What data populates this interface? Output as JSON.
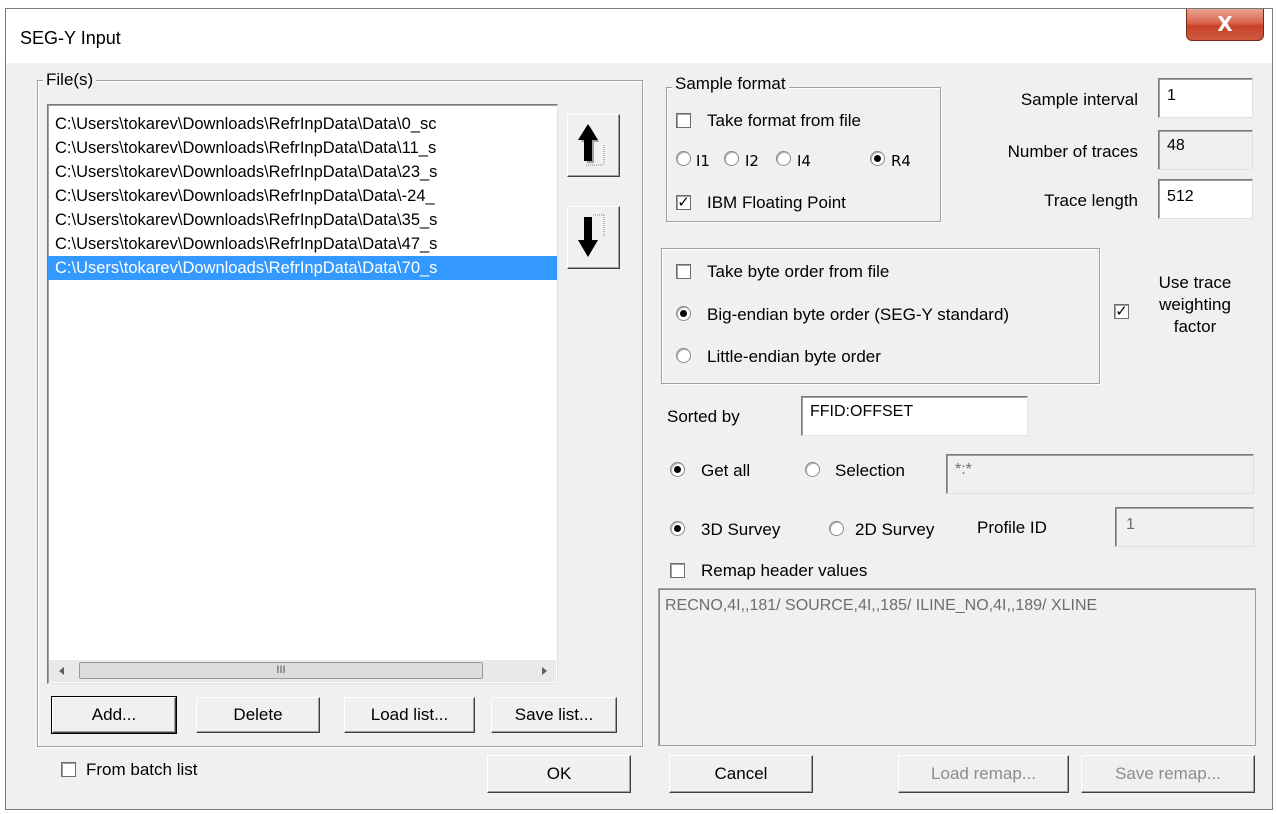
{
  "window": {
    "title": "SEG-Y Input",
    "close_label": "X"
  },
  "files": {
    "group_label": "File(s)",
    "items": [
      "C:\\Users\\tokarev\\Downloads\\RefrInpData\\Data\\0_sc",
      "C:\\Users\\tokarev\\Downloads\\RefrInpData\\Data\\11_s",
      "C:\\Users\\tokarev\\Downloads\\RefrInpData\\Data\\23_s",
      "C:\\Users\\tokarev\\Downloads\\RefrInpData\\Data\\-24_",
      "C:\\Users\\tokarev\\Downloads\\RefrInpData\\Data\\35_s",
      "C:\\Users\\tokarev\\Downloads\\RefrInpData\\Data\\47_s",
      "C:\\Users\\tokarev\\Downloads\\RefrInpData\\Data\\70_s"
    ],
    "selected_index": 6,
    "scroll_grip": "III",
    "buttons": {
      "add": "Add...",
      "delete": "Delete",
      "load_list": "Load list...",
      "save_list": "Save list..."
    },
    "from_batch_list": "From batch list"
  },
  "sample_format": {
    "group_label": "Sample format",
    "take_from_file": "Take format from file",
    "formats": [
      "I1",
      "I2",
      "I4",
      "R4"
    ],
    "selected_format": "R4",
    "ibm_floating_point": "IBM Floating Point"
  },
  "params": {
    "sample_interval_label": "Sample interval",
    "sample_interval": "1",
    "num_traces_label": "Number of traces",
    "num_traces": "48",
    "trace_length_label": "Trace length",
    "trace_length": "512"
  },
  "byte_order": {
    "take_from_file": "Take byte order from file",
    "big_endian": "Big-endian byte order (SEG-Y standard)",
    "little_endian": "Little-endian byte order",
    "selected": "big"
  },
  "use_trace_weighting": {
    "line1": "Use trace",
    "line2": "weighting",
    "line3": "factor"
  },
  "sorted_by": {
    "label": "Sorted by",
    "value": "FFID:OFFSET"
  },
  "selection": {
    "get_all": "Get all",
    "selection": "Selection",
    "value": "*:*"
  },
  "survey": {
    "survey_3d": "3D Survey",
    "survey_2d": "2D Survey",
    "profile_id_label": "Profile ID",
    "profile_id": "1"
  },
  "remap": {
    "checkbox_label": "Remap header values",
    "text": "RECNO,4I,,181/ SOURCE,4I,,185/ ILINE_NO,4I,,189/ XLINE"
  },
  "footer": {
    "ok": "OK",
    "cancel": "Cancel",
    "load_remap": "Load remap...",
    "save_remap": "Save remap..."
  },
  "colors": {
    "selection": "#3399ff",
    "dialog_bg": "#f0f0f0",
    "close_button": "#c7402a"
  }
}
